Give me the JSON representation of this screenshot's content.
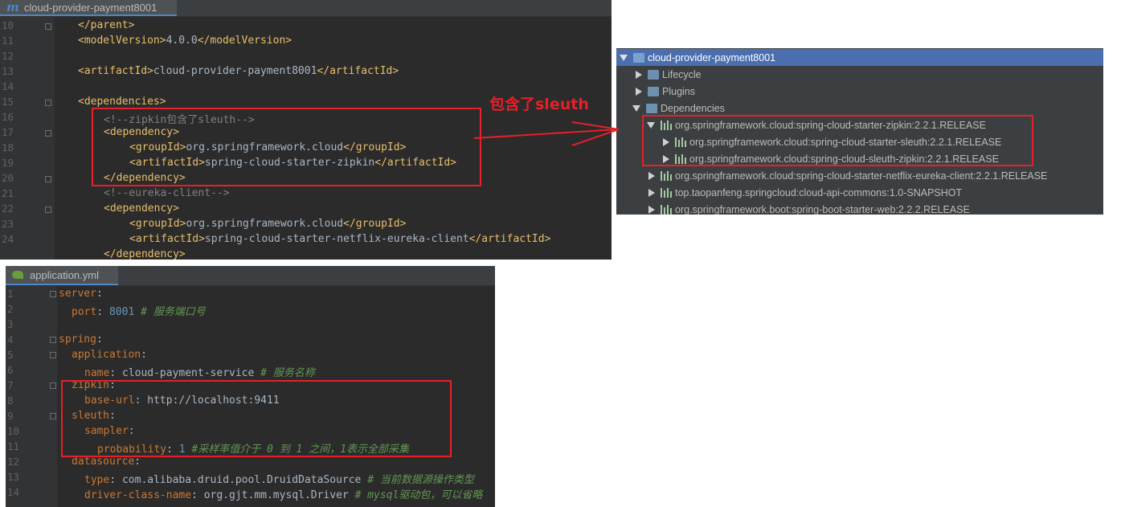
{
  "pom": {
    "tab": "cloud-provider-payment8001",
    "tab_icon": "m",
    "lines": [
      {
        "n": "10",
        "parts": [
          [
            "tag",
            "</parent>"
          ]
        ]
      },
      {
        "n": "11",
        "parts": [
          [
            "tag",
            "<modelVersion>"
          ],
          [
            "txt",
            "4.0.0"
          ],
          [
            "tag",
            "</modelVersion>"
          ]
        ]
      },
      {
        "n": "12",
        "parts": []
      },
      {
        "n": "13",
        "parts": [
          [
            "tag",
            "<artifactId>"
          ],
          [
            "txt",
            "cloud-provider-payment8001"
          ],
          [
            "tag",
            "</artifactId>"
          ]
        ]
      },
      {
        "n": "14",
        "parts": []
      },
      {
        "n": "15",
        "parts": [
          [
            "tag",
            "<dependencies>"
          ]
        ]
      },
      {
        "n": "16",
        "parts": [
          [
            "cmt",
            "<!--zipkin包含了sleuth-->"
          ]
        ]
      },
      {
        "n": "17",
        "parts": [
          [
            "tag",
            "<dependency>"
          ]
        ]
      },
      {
        "n": "18",
        "parts": [
          [
            "tag",
            "<groupId>"
          ],
          [
            "txt",
            "org.springframework.cloud"
          ],
          [
            "tag",
            "</groupId>"
          ]
        ]
      },
      {
        "n": "19",
        "parts": [
          [
            "tag",
            "<artifactId>"
          ],
          [
            "txt",
            "spring-cloud-starter-zipkin"
          ],
          [
            "tag",
            "</artifactId>"
          ]
        ]
      },
      {
        "n": "20",
        "parts": [
          [
            "tag",
            "</dependency>"
          ]
        ]
      },
      {
        "n": "21",
        "parts": [
          [
            "cmt",
            "<!--eureka-client-->"
          ]
        ]
      },
      {
        "n": "22",
        "parts": [
          [
            "tag",
            "<dependency>"
          ]
        ]
      },
      {
        "n": "23",
        "parts": [
          [
            "tag",
            "<groupId>"
          ],
          [
            "txt",
            "org.springframework.cloud"
          ],
          [
            "tag",
            "</groupId>"
          ]
        ]
      },
      {
        "n": "24",
        "parts": [
          [
            "tag",
            "<artifactId>"
          ],
          [
            "txt",
            "spring-cloud-starter-netflix-eureka-client"
          ],
          [
            "tag",
            "</artifactId>"
          ]
        ]
      },
      {
        "n": "",
        "parts": [
          [
            "tag",
            "</dependency>"
          ]
        ]
      }
    ]
  },
  "annotation": "包含了sleuth",
  "maven": {
    "root": "cloud-provider-payment8001",
    "lifecycle": "Lifecycle",
    "plugins": "Plugins",
    "dependencies": "Dependencies",
    "deps": [
      "org.springframework.cloud:spring-cloud-starter-zipkin:2.2.1.RELEASE",
      "org.springframework.cloud:spring-cloud-starter-sleuth:2.2.1.RELEASE",
      "org.springframework.cloud:spring-cloud-sleuth-zipkin:2.2.1.RELEASE",
      "org.springframework.cloud:spring-cloud-starter-netflix-eureka-client:2.2.1.RELEASE",
      "top.taopanfeng.springcloud:cloud-api-commons:1.0-SNAPSHOT",
      "org.springframework.boot:spring-boot-starter-web:2.2.2.RELEASE"
    ]
  },
  "yml": {
    "tab": "application.yml",
    "lines": [
      {
        "n": "1",
        "parts": [
          [
            "key",
            "server"
          ],
          [
            "txt",
            ":"
          ]
        ]
      },
      {
        "n": "2",
        "parts": [
          [
            "key",
            "port"
          ],
          [
            "txt",
            ": "
          ],
          [
            "num",
            "8001"
          ],
          [
            "txt",
            " "
          ],
          [
            "ycm",
            "# 服务端口号"
          ]
        ]
      },
      {
        "n": "3",
        "parts": []
      },
      {
        "n": "4",
        "parts": [
          [
            "key",
            "spring"
          ],
          [
            "txt",
            ":"
          ]
        ]
      },
      {
        "n": "5",
        "parts": [
          [
            "key",
            "application"
          ],
          [
            "txt",
            ":"
          ]
        ]
      },
      {
        "n": "6",
        "parts": [
          [
            "key",
            "name"
          ],
          [
            "txt",
            ": cloud-payment-service "
          ],
          [
            "ycm",
            "# 服务名称"
          ]
        ]
      },
      {
        "n": "7",
        "parts": [
          [
            "key",
            "zipkin"
          ],
          [
            "txt",
            ":"
          ]
        ]
      },
      {
        "n": "8",
        "parts": [
          [
            "key",
            "base-url"
          ],
          [
            "txt",
            ": http://localhost:9411"
          ]
        ]
      },
      {
        "n": "9",
        "parts": [
          [
            "key",
            "sleuth"
          ],
          [
            "txt",
            ":"
          ]
        ]
      },
      {
        "n": "10",
        "parts": [
          [
            "key",
            "sampler"
          ],
          [
            "txt",
            ":"
          ]
        ]
      },
      {
        "n": "11",
        "parts": [
          [
            "key",
            "probability"
          ],
          [
            "txt",
            ": "
          ],
          [
            "num",
            "1"
          ],
          [
            "txt",
            " "
          ],
          [
            "ycm",
            "#采样率值介于 0 到 1 之间，1表示全部采集"
          ]
        ]
      },
      {
        "n": "12",
        "parts": [
          [
            "key",
            "datasource"
          ],
          [
            "txt",
            ":"
          ]
        ]
      },
      {
        "n": "13",
        "parts": [
          [
            "key",
            "type"
          ],
          [
            "txt",
            ": com.alibaba.druid.pool.DruidDataSource "
          ],
          [
            "ycm",
            "# 当前数据源操作类型"
          ]
        ]
      },
      {
        "n": "14",
        "parts": [
          [
            "key",
            "driver-class-name"
          ],
          [
            "txt",
            ": org.gjt.mm.mysql.Driver "
          ],
          [
            "ycm",
            "# mysql驱动包，可以省略"
          ]
        ]
      }
    ]
  }
}
